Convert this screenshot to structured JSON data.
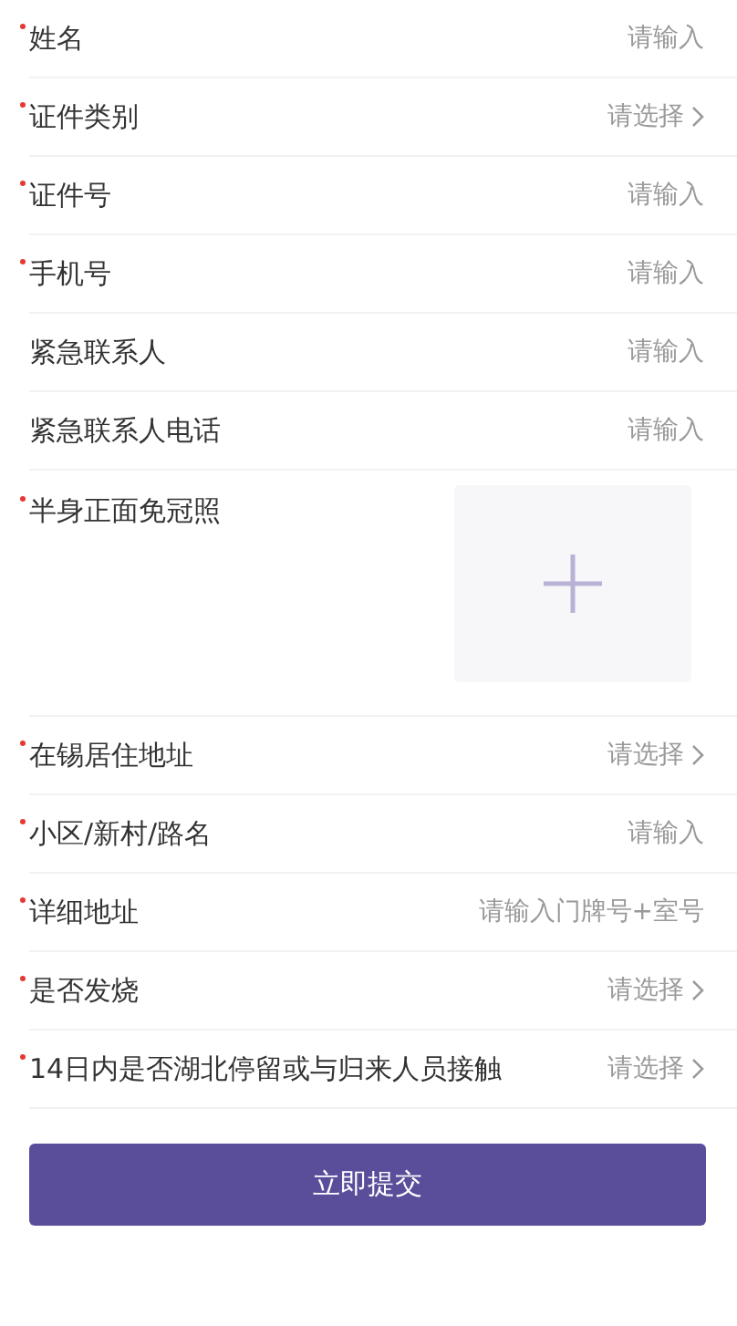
{
  "fields": [
    {
      "kind": "input",
      "label": "姓名",
      "required": true,
      "placeholder": "请输入"
    },
    {
      "kind": "select",
      "label": "证件类别",
      "required": true,
      "placeholder": "请选择"
    },
    {
      "kind": "input",
      "label": "证件号",
      "required": true,
      "placeholder": "请输入"
    },
    {
      "kind": "input",
      "label": "手机号",
      "required": true,
      "placeholder": "请输入"
    },
    {
      "kind": "input",
      "label": "紧急联系人",
      "required": false,
      "placeholder": "请输入"
    },
    {
      "kind": "input",
      "label": "紧急联系人电话",
      "required": false,
      "placeholder": "请输入"
    },
    {
      "kind": "photo",
      "label": "半身正面免冠照",
      "required": true
    },
    {
      "kind": "select",
      "label": "在锡居住地址",
      "required": true,
      "placeholder": "请选择"
    },
    {
      "kind": "input",
      "label": "小区/新村/路名",
      "required": true,
      "placeholder": "请输入"
    },
    {
      "kind": "input",
      "label": "详细地址",
      "required": true,
      "placeholder": "请输入门牌号+室号"
    },
    {
      "kind": "select",
      "label": "是否发烧",
      "required": true,
      "placeholder": "请选择"
    },
    {
      "kind": "select",
      "label": "14日内是否湖北停留或与归来人员接触",
      "required": true,
      "placeholder": "请选择"
    }
  ],
  "submit": "立即提交"
}
